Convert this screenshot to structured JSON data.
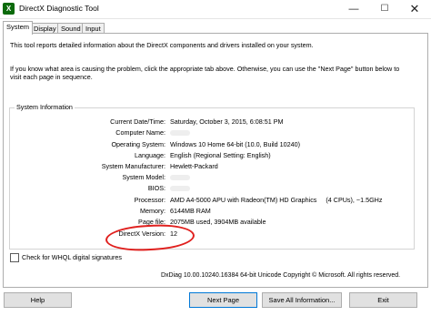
{
  "window": {
    "title": "DirectX Diagnostic Tool",
    "icon": "directx-app-icon",
    "controls": {
      "minimize": "—",
      "maximize": "☐",
      "close": "✕"
    }
  },
  "tabs": [
    {
      "label": "System",
      "active": true
    },
    {
      "label": "Display",
      "active": false
    },
    {
      "label": "Sound",
      "active": false
    },
    {
      "label": "Input",
      "active": false
    }
  ],
  "intro": {
    "line1": "This tool reports detailed information about the DirectX components and drivers installed on your system.",
    "line2": "If you know what area is causing the problem, click the appropriate tab above.  Otherwise, you can use the \"Next Page\" button below to visit each page in sequence."
  },
  "system_info": {
    "legend": "System Information",
    "rows": [
      {
        "label": "Current Date/Time:",
        "value": "Saturday, October 3, 2015, 6:08:51 PM"
      },
      {
        "label": "Computer Name:",
        "value": ""
      },
      {
        "label": "Operating System:",
        "value": "Windows 10 Home 64-bit (10.0, Build 10240)"
      },
      {
        "label": "Language:",
        "value": "English (Regional Setting: English)"
      },
      {
        "label": "System Manufacturer:",
        "value": "Hewlett-Packard"
      },
      {
        "label": "System Model:",
        "value": ""
      },
      {
        "label": "BIOS:",
        "value": ""
      },
      {
        "label": "Processor:",
        "value": "AMD A4-5000 APU with Radeon(TM) HD Graphics     (4 CPUs), ~1.5GHz"
      },
      {
        "label": "Memory:",
        "value": "6144MB RAM"
      },
      {
        "label": "Page file:",
        "value": "2075MB used, 3904MB available"
      },
      {
        "label": "DirectX Version:",
        "value": "12"
      }
    ]
  },
  "annotation": {
    "color": "#e0201e"
  },
  "whql": {
    "label": "Check for WHQL digital signatures",
    "checked": false
  },
  "copyright": "DxDiag 10.00.10240.16384 64-bit Unicode  Copyright © Microsoft. All rights reserved.",
  "buttons": {
    "help": "Help",
    "next": "Next Page",
    "save": "Save All Information...",
    "exit": "Exit"
  }
}
